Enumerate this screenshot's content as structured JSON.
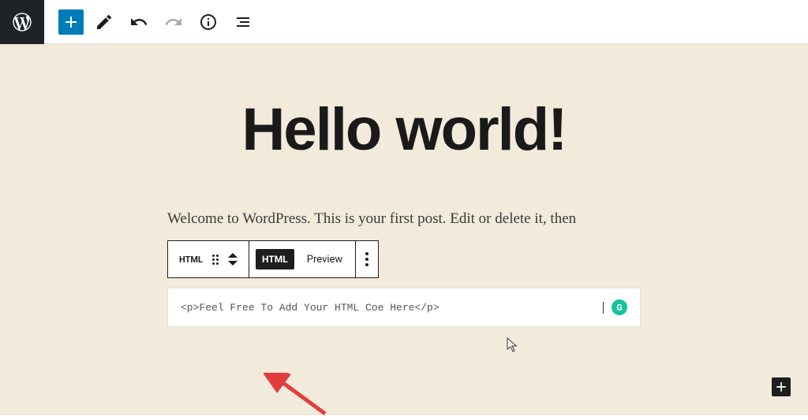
{
  "toolbar": {
    "add_label": "+",
    "modes_label": "Modes",
    "undo_label": "Undo",
    "redo_label": "Redo",
    "info_label": "Details",
    "outline_label": "Outline"
  },
  "post": {
    "title": "Hello world!",
    "paragraph": "Welcome to WordPress. This is your first post. Edit or delete it, then"
  },
  "block_toolbar": {
    "type_label": "HTML",
    "html_button": "HTML",
    "preview_button": "Preview"
  },
  "html_block": {
    "code": "<p>Feel Free To Add Your HTML Coe Here</p>"
  },
  "badges": {
    "grammarly": "G"
  }
}
